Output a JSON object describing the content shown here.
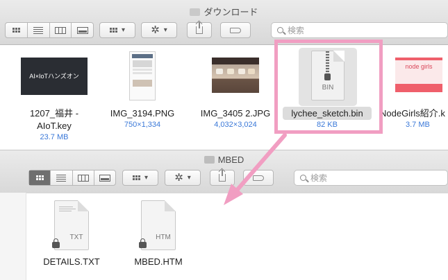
{
  "top_window": {
    "title": "ダウンロード",
    "search_placeholder": "検索",
    "files": [
      {
        "name": "1207_福井 -",
        "name2": "AIoT.key",
        "meta": "23.7 MB",
        "thumb_text": "AI×IoTハンズオン"
      },
      {
        "name": "IMG_3194.PNG",
        "meta": "750×1,334"
      },
      {
        "name": "IMG_3405 2.JPG",
        "meta": "4,032×3,024"
      },
      {
        "name": "lychee_sketch.bin",
        "meta": "82 KB",
        "ext": "BIN"
      },
      {
        "name": "NodeGirls紹介.k",
        "meta": "3.7 MB",
        "thumb_text": "node girls"
      }
    ]
  },
  "bottom_window": {
    "title": "MBED",
    "search_placeholder": "検索",
    "files": [
      {
        "name": "DETAILS.TXT",
        "ext": "TXT"
      },
      {
        "name": "MBED.HTM",
        "ext": "HTM"
      }
    ]
  },
  "annotation": {
    "highlight_color": "#f19ec2"
  }
}
